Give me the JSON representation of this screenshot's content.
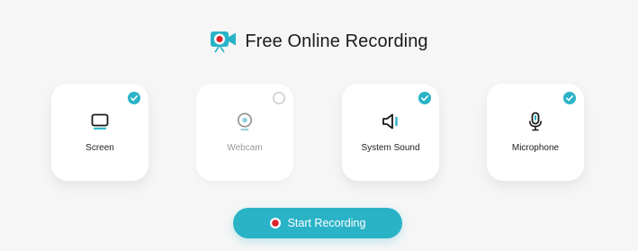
{
  "header": {
    "title": "Free Online Recording",
    "logo_icon": "video-camera-record-icon"
  },
  "options": [
    {
      "label": "Screen",
      "icon": "monitor-icon",
      "checked": true
    },
    {
      "label": "Webcam",
      "icon": "webcam-icon",
      "checked": false
    },
    {
      "label": "System Sound",
      "icon": "speaker-icon",
      "checked": true
    },
    {
      "label": "Microphone",
      "icon": "microphone-icon",
      "checked": true
    }
  ],
  "start_button": {
    "label": "Start Recording",
    "icon": "record-dot-icon"
  },
  "colors": {
    "accent": "#2ab3c7",
    "record_red": "#e0232b",
    "background": "#f6f6f6"
  }
}
